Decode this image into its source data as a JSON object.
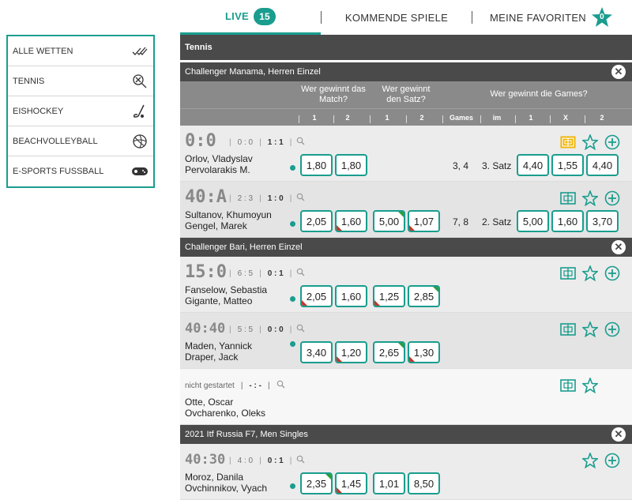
{
  "tabs": {
    "live_label": "LIVE",
    "live_count": "15",
    "upcoming_label": "KOMMENDE SPIELE",
    "favorites_label": "MEINE FAVORITEN",
    "favorites_count": "0"
  },
  "sidebar": {
    "items": [
      {
        "label": "ALLE WETTEN",
        "icon": "all-bets-icon"
      },
      {
        "label": "TENNIS",
        "icon": "tennis-racket-icon"
      },
      {
        "label": "EISHOCKEY",
        "icon": "hockey-stick-icon"
      },
      {
        "label": "BEACHVOLLEYBALL",
        "icon": "volleyball-icon"
      },
      {
        "label": "E-SPORTS FUSSBALL",
        "icon": "gamepad-icon"
      }
    ]
  },
  "main": {
    "sport": "Tennis",
    "header": {
      "match_winner": "Wer gewinnt das Match?",
      "set_winner": "Wer gewinnt den Satz?",
      "games_winner": "Wer gewinnt die Games?",
      "col_1a": "1",
      "col_2a": "2",
      "col_1b": "1",
      "col_2b": "2",
      "col_games": "Games",
      "col_im": "im",
      "col_1c": "1",
      "col_x": "X",
      "col_2c": "2"
    },
    "leagues": [
      {
        "name": "Challenger Manama, Herren Einzel"
      },
      {
        "name": "Challenger Bari, Herren Einzel"
      },
      {
        "name": "2021 Itf Russia F7, Men Singles"
      }
    ],
    "matches": [
      {
        "score": "0:0",
        "sets": "0 : 0",
        "current": "1 : 1",
        "p1": "Orlov, Vladyslav",
        "p2": "Pervolarakis M.",
        "m1": "1,80",
        "m2": "1,80",
        "games": "3, 4",
        "im": "3. Satz",
        "g1": "4,40",
        "gx": "1,55",
        "g2": "4,40"
      },
      {
        "score": "40:A",
        "sets": "2 : 3",
        "current": "1 : 0",
        "p1": "Sultanov, Khumoyun",
        "p2": "Gengel, Marek",
        "m1": "2,05",
        "m2": "1,60",
        "s1": "5,00",
        "s2": "1,07",
        "games": "7, 8",
        "im": "2. Satz",
        "g1": "5,00",
        "gx": "1,60",
        "g2": "3,70"
      },
      {
        "score": "15:0",
        "sets": "6 : 5",
        "current": "0 : 1",
        "p1": "Fanselow, Sebastia",
        "p2": "Gigante, Matteo",
        "m1": "2,05",
        "m2": "1,60",
        "s1": "1,25",
        "s2": "2,85"
      },
      {
        "score": "40:40",
        "sets": "5 : 5",
        "current": "0 : 0",
        "p1": "Maden, Yannick",
        "p2": "Draper, Jack",
        "m1": "3,40",
        "m2": "1,20",
        "s1": "2,65",
        "s2": "1,30"
      },
      {
        "status": "nicht gestartet",
        "current": "- : -",
        "p1": "Otte, Oscar",
        "p2": "Ovcharenko, Oleks"
      },
      {
        "score": "40:30",
        "sets": "4 : 0",
        "current": "0 : 1",
        "p1": "Moroz, Danila",
        "p2": "Ovchinnikov, Vyach",
        "m1": "2,35",
        "m2": "1,45",
        "s1": "1,01",
        "s2": "8,50"
      }
    ]
  },
  "colors": {
    "accent": "#1a9d8e",
    "header_dark": "#4a4a4a",
    "header_gray": "#8a8a8a",
    "up": "#2a9d3e",
    "down": "#c0392b",
    "stats_yellow": "#f0b400"
  }
}
